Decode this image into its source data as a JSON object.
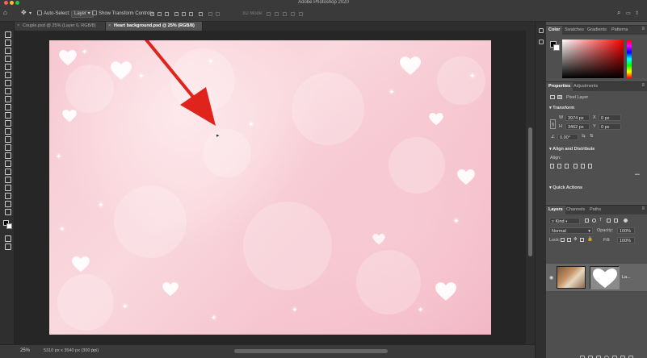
{
  "app": {
    "title": "Adobe Photoshop 2020",
    "traffic_colors": [
      "#ff5f57",
      "#febc2e",
      "#28c840"
    ]
  },
  "options_bar": {
    "auto_select_label": "Auto-Select:",
    "auto_select_target": "Layer",
    "show_transform_label": "Show Transform Controls",
    "mode_3d_label": "3D Mode:",
    "move_icon": "move-tool-icon"
  },
  "tabs": [
    {
      "label": "Couple.psd @ 25% (Layer 0, RGB/8)",
      "close": "×",
      "active": false
    },
    {
      "label": "Heart background.psd @ 25% (RGB/8)",
      "close": "×",
      "active": true
    }
  ],
  "status": {
    "zoom": "25%",
    "doc_info": "5310 px x 3540 px (300 ppi)",
    "chevron": "›"
  },
  "color_panel": {
    "tabs": [
      "Color",
      "Swatches",
      "Gradients",
      "Patterns"
    ],
    "menu": "≡",
    "foreground": "#000000",
    "background": "#ffffff"
  },
  "properties_panel": {
    "tabs": [
      "Properties",
      "Adjustments"
    ],
    "menu": "≡",
    "layer_kind": "Pixel Layer",
    "transform_title": "Transform",
    "w_label": "W",
    "w_value": "3974 px",
    "h_label": "H",
    "h_value": "3462 px",
    "x_label": "X",
    "x_value": "0 px",
    "y_label": "Y",
    "y_value": "0 px",
    "angle_value": "0.00°",
    "align_title": "Align and Distribute",
    "align_label": "Align:",
    "quick_actions_title": "Quick Actions",
    "more": "•••"
  },
  "layers_panel": {
    "tabs": [
      "Layers",
      "Channels",
      "Paths"
    ],
    "menu": "≡",
    "filter_kind": "Kind",
    "blend_mode": "Normal",
    "opacity_label": "Opacity:",
    "opacity_value": "100%",
    "lock_label": "Lock:",
    "fill_label": "Fill:",
    "fill_value": "100%",
    "layer_name": "La..."
  },
  "annotation": {
    "arrow_color": "#e0231b"
  }
}
